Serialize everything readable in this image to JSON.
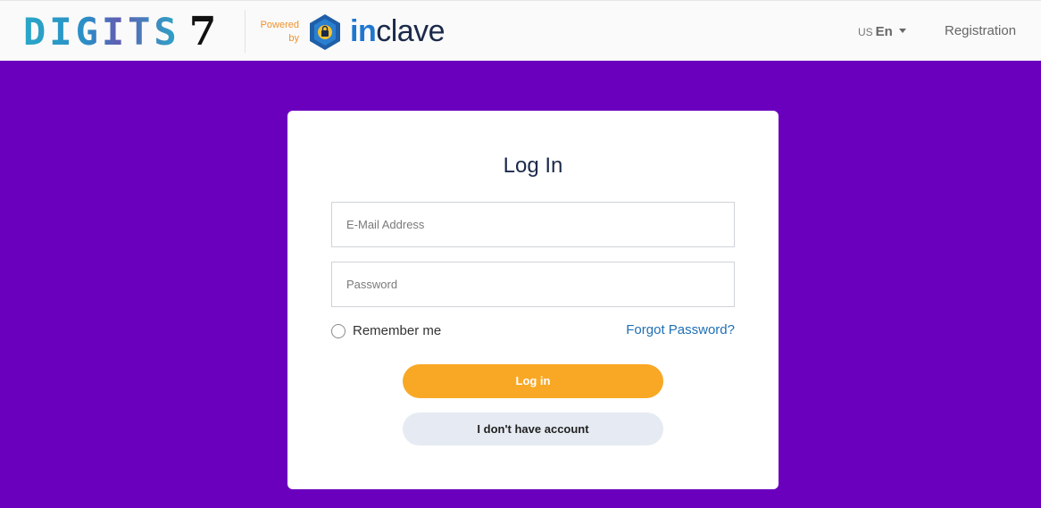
{
  "header": {
    "logo_word": "DIGITS",
    "logo_number": "7",
    "powered_line1": "Powered",
    "powered_line2": "by",
    "brand_prefix": "in",
    "brand_suffix": "clave",
    "language": {
      "flag": "US",
      "code": "En"
    },
    "registration_label": "Registration"
  },
  "login": {
    "title": "Log In",
    "email_placeholder": "E-Mail Address",
    "email_value": "",
    "password_placeholder": "Password",
    "password_value": "",
    "remember_label": "Remember me",
    "forgot_label": "Forgot Password?",
    "login_button": "Log in",
    "no_account_button": "I don't have account"
  },
  "colors": {
    "background": "#6a00be",
    "primary_button": "#f9a825",
    "secondary_button": "#e6ebf3",
    "link": "#1f6fb5"
  }
}
